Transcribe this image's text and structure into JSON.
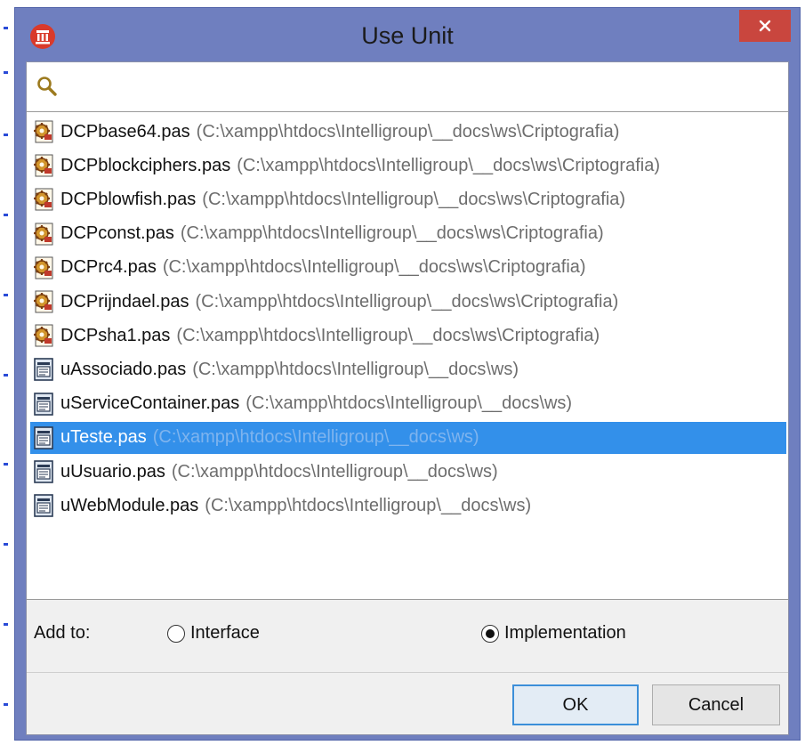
{
  "window": {
    "title": "Use Unit",
    "close_glyph": "✕"
  },
  "search": {
    "value": "",
    "placeholder": ""
  },
  "units": [
    {
      "name": "DCPbase64.pas",
      "path": "(C:\\xampp\\htdocs\\Intelligroup\\__docs\\ws\\Criptografia)",
      "icon": "gear-unit-icon",
      "selected": false
    },
    {
      "name": "DCPblockciphers.pas",
      "path": "(C:\\xampp\\htdocs\\Intelligroup\\__docs\\ws\\Criptografia)",
      "icon": "gear-unit-icon",
      "selected": false
    },
    {
      "name": "DCPblowfish.pas",
      "path": "(C:\\xampp\\htdocs\\Intelligroup\\__docs\\ws\\Criptografia)",
      "icon": "gear-unit-icon",
      "selected": false
    },
    {
      "name": "DCPconst.pas",
      "path": "(C:\\xampp\\htdocs\\Intelligroup\\__docs\\ws\\Criptografia)",
      "icon": "gear-unit-icon",
      "selected": false
    },
    {
      "name": "DCPrc4.pas",
      "path": "(C:\\xampp\\htdocs\\Intelligroup\\__docs\\ws\\Criptografia)",
      "icon": "gear-unit-icon",
      "selected": false
    },
    {
      "name": "DCPrijndael.pas",
      "path": "(C:\\xampp\\htdocs\\Intelligroup\\__docs\\ws\\Criptografia)",
      "icon": "gear-unit-icon",
      "selected": false
    },
    {
      "name": "DCPsha1.pas",
      "path": "(C:\\xampp\\htdocs\\Intelligroup\\__docs\\ws\\Criptografia)",
      "icon": "gear-unit-icon",
      "selected": false
    },
    {
      "name": "uAssociado.pas",
      "path": "(C:\\xampp\\htdocs\\Intelligroup\\__docs\\ws)",
      "icon": "form-unit-icon",
      "selected": false
    },
    {
      "name": "uServiceContainer.pas",
      "path": "(C:\\xampp\\htdocs\\Intelligroup\\__docs\\ws)",
      "icon": "form-unit-icon",
      "selected": false
    },
    {
      "name": "uTeste.pas",
      "path": "(C:\\xampp\\htdocs\\Intelligroup\\__docs\\ws)",
      "icon": "form-unit-icon",
      "selected": true
    },
    {
      "name": "uUsuario.pas",
      "path": "(C:\\xampp\\htdocs\\Intelligroup\\__docs\\ws)",
      "icon": "form-unit-icon",
      "selected": false
    },
    {
      "name": "uWebModule.pas",
      "path": "(C:\\xampp\\htdocs\\Intelligroup\\__docs\\ws)",
      "icon": "form-unit-icon",
      "selected": false
    }
  ],
  "add_to": {
    "label": "Add to:",
    "options": [
      {
        "label": "Interface",
        "checked": false
      },
      {
        "label": "Implementation",
        "checked": true
      }
    ]
  },
  "buttons": {
    "ok": "OK",
    "cancel": "Cancel"
  },
  "colors": {
    "selection": "#3390ea",
    "frame": "#6f7fbf",
    "close": "#c9463e"
  }
}
